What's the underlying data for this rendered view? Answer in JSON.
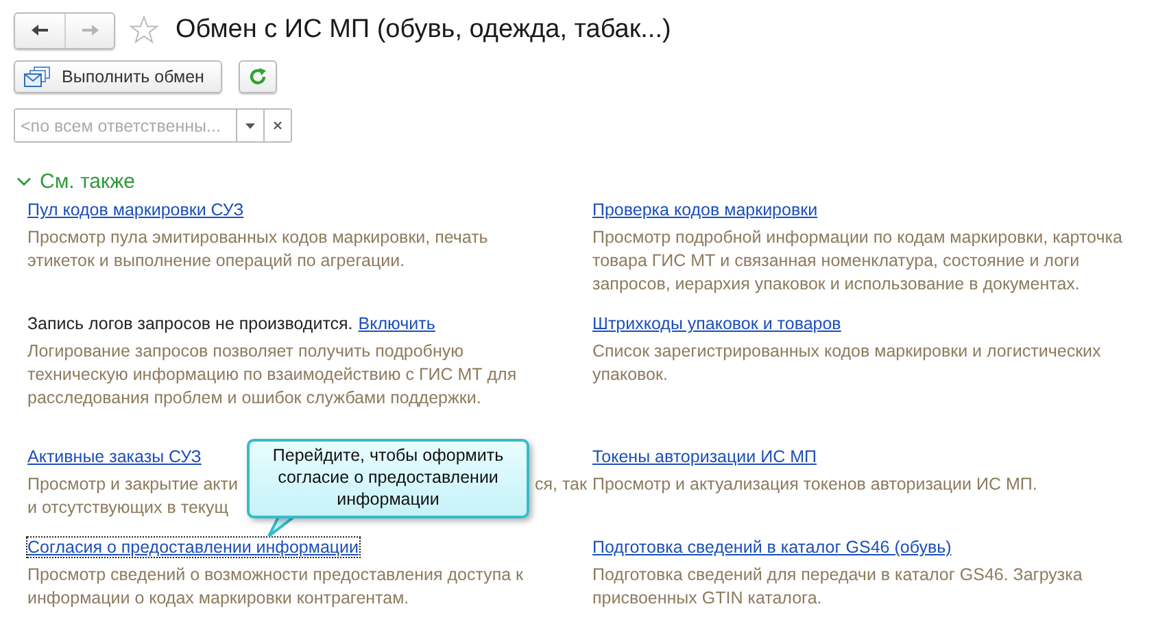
{
  "window": {
    "title": "Обмен с ИС МП (обувь, одежда, табак...)",
    "favorite": false
  },
  "nav": {
    "back": {
      "disabled": false
    },
    "forward": {
      "disabled": true
    }
  },
  "toolbar": {
    "exchange_button": "Выполнить обмен"
  },
  "filter": {
    "placeholder": "<по всем ответственны..."
  },
  "section": {
    "title": "См. также",
    "expanded": true
  },
  "left": [
    {
      "kind": "link",
      "title": "Пул кодов маркировки СУЗ",
      "focused": false,
      "description": "Просмотр пула эмитированных кодов маркировки, печать этикеток и выполнение операций по агрегации."
    },
    {
      "kind": "status",
      "text": "Запись логов запросов не производится.",
      "action": "Включить",
      "description": "Логирование запросов позволяет получить подробную техническую информацию по взаимодействию с ГИС МТ для расследования проблем и ошибок службами поддержки."
    },
    {
      "kind": "covered",
      "title": "Активные заказы СУЗ",
      "focused": false,
      "description_visible": [
        "Просмотр и закрытие акти",
        "ся, так",
        "и отсутствующих в текущ"
      ]
    },
    {
      "kind": "link",
      "title": "Согласия о предоставлении информации",
      "focused": true,
      "description": "Просмотр сведений о возможности предоставления доступа к информации о кодах маркировки контрагентам."
    }
  ],
  "right": [
    {
      "kind": "link",
      "title": "Проверка кодов маркировки",
      "focused": false,
      "description": "Просмотр подробной информации по кодам маркировки, карточка товара ГИС МТ и связанная номенклатура, состояние и логи запросов, иерархия упаковок и использование в документах."
    },
    {
      "kind": "link",
      "title": "Штрихкоды упаковок и товаров",
      "focused": false,
      "description": "Список зарегистрированных кодов маркировки и логистических упаковок."
    },
    {
      "kind": "link",
      "title": "Токены авторизации ИС МП",
      "focused": false,
      "description": "Просмотр и актуализация токенов авторизации ИС МП."
    },
    {
      "kind": "link",
      "title": "Подготовка сведений в каталог GS46 (обувь)",
      "focused": false,
      "description": "Подготовка сведений для передачи в каталог GS46. Загрузка присвоенных GTIN каталога."
    }
  ],
  "tooltip": {
    "text": "Перейдите, чтобы оформить согласие о предоставлении информации"
  }
}
